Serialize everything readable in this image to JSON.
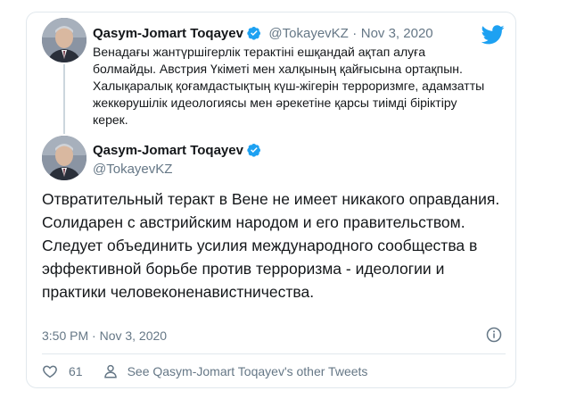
{
  "colors": {
    "accent": "#1da1f2",
    "text": "#14171a",
    "muted": "#657786",
    "border": "#e1e8ed"
  },
  "quoted": {
    "name": "Qasym-Jomart Toqayev",
    "handle": "@TokayevKZ",
    "separator": "·",
    "date": "Nov 3, 2020",
    "text": "Венадағы жантүршігерлік терактіні ешқандай ақтап алуға болмайды. Австрия Үкіметі мен халқының қайғысына ортақпын. Халықаралық қоғамдастықтың күш-жігерін терроризмге, адамзатты жеккөрушілік идеологиясы мен әрекетіне қарсы тиімді біріктіру керек."
  },
  "tweet": {
    "name": "Qasym-Jomart Toqayev",
    "handle": "@TokayevKZ",
    "text": "Отвратительный теракт в Вене не имеет никакого оправдания. Солидарен с австрийским народом и его правительством. Следует объединить усилия международного сообщества в эффективной борьбе против терроризма - идеологии и практики человеконенавистничества.",
    "timestamp": "3:50 PM · Nov 3, 2020",
    "likes": "61",
    "other_tweets_label": "See Qasym-Jomart Toqayev's other Tweets"
  },
  "icons": [
    "twitter-bird-icon",
    "verified-badge-icon",
    "info-icon",
    "heart-icon",
    "person-icon"
  ]
}
